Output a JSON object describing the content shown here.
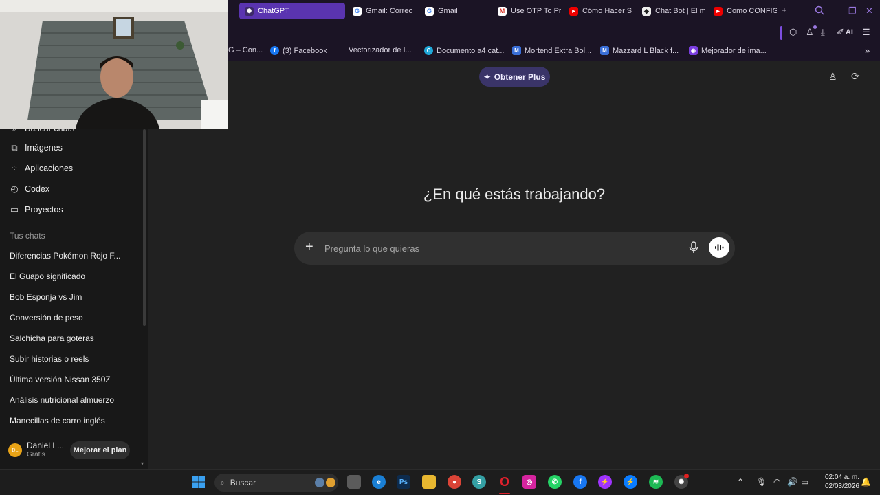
{
  "browser": {
    "tabs": [
      {
        "label": "ChatGPT",
        "icon": "chatgpt-icon",
        "active": true
      },
      {
        "label": "Gmail: Correo",
        "icon": "google-icon"
      },
      {
        "label": "Gmail",
        "icon": "google-icon"
      },
      {
        "label": "Use OTP To Pr",
        "icon": "gmail-icon"
      },
      {
        "label": "Cómo Hacer S",
        "icon": "youtube-icon"
      },
      {
        "label": "Chat Bot | El m",
        "icon": "chatbot-icon"
      },
      {
        "label": "Como CONFIGU",
        "icon": "youtube-icon"
      }
    ],
    "new_tab": "+",
    "ai_label": "AI",
    "bookmarks": [
      {
        "label": "G – Con...",
        "icon": ""
      },
      {
        "label": "(3) Facebook",
        "icon": "facebook-icon"
      },
      {
        "label": "Vectorizador de I...",
        "icon": ""
      },
      {
        "label": "Documento a4 cat...",
        "icon": "canva-icon"
      },
      {
        "label": "Mortend Extra Bol...",
        "icon": "font-icon"
      },
      {
        "label": "Mazzard L Black f...",
        "icon": "font-icon"
      },
      {
        "label": "Mejorador de ima...",
        "icon": "image-tool-icon"
      }
    ]
  },
  "sidebar": {
    "partial_top": "Buscar chats",
    "items": [
      {
        "label": "Imágenes",
        "icon": "images-icon"
      },
      {
        "label": "Aplicaciones",
        "icon": "apps-icon"
      },
      {
        "label": "Codex",
        "icon": "codex-icon"
      },
      {
        "label": "Proyectos",
        "icon": "folder-icon"
      }
    ],
    "section_title": "Tus chats",
    "chats": [
      "Diferencias Pokémon Rojo F...",
      "El Guapo significado",
      "Bob Esponja vs Jim",
      "Conversión de peso",
      "Salchicha para goteras",
      "Subir historias o reels",
      "Última versión Nissan 350Z",
      "Análisis nutricional almuerzo",
      "Manecillas de carro inglés"
    ],
    "user": {
      "initials": "DL",
      "name": "Daniel L...",
      "plan": "Gratis",
      "upgrade_label": "Mejorar el plan"
    }
  },
  "main": {
    "plus_label": "Obtener Plus",
    "headline": "¿En qué estás trabajando?",
    "composer_placeholder": "Pregunta lo que quieras"
  },
  "taskbar": {
    "search_label": "Buscar",
    "time": "02:04 a. m.",
    "date": "02/03/2026"
  },
  "colors": {
    "accent": "#5a34b0",
    "plus_bg": "#3a3468",
    "bg": "#212121",
    "sidebar": "#181818"
  }
}
